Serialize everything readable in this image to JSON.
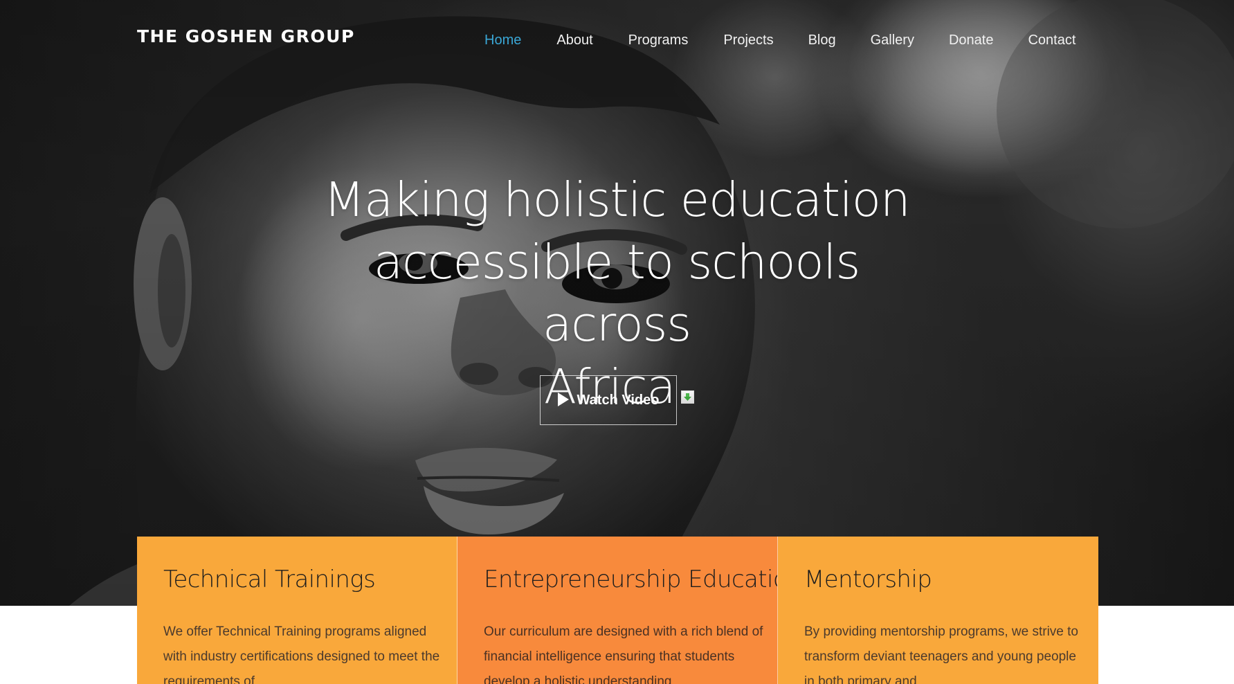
{
  "header": {
    "brand": "THE GOSHEN GROUP",
    "nav": [
      {
        "label": "Home"
      },
      {
        "label": "About"
      },
      {
        "label": "Programs"
      },
      {
        "label": "Projects"
      },
      {
        "label": "Blog"
      },
      {
        "label": "Gallery"
      },
      {
        "label": "Donate"
      },
      {
        "label": "Contact"
      }
    ]
  },
  "hero": {
    "title_line_1": "Making holistic education",
    "title_line_2": "accessible to schools across",
    "title_line_3": "Africa.",
    "watch_video": "Watch Video"
  },
  "cards": [
    {
      "title": "Technical Trainings",
      "text": "We offer Technical Training programs aligned with industry certifications designed to meet the requirements of"
    },
    {
      "title": "Entrepreneurship Education",
      "text": "Our curriculum are designed with a rich blend of financial intelligence ensuring that students develop a holistic understanding"
    },
    {
      "title": "Mentorship",
      "text": "By providing mentorship programs, we strive to transform deviant teenagers and young people in both primary and"
    }
  ],
  "colors": {
    "nav_active": "#3aa7d6",
    "card_orange": "#f9a83b",
    "card_deep_orange": "#f88a3c"
  },
  "icons": {
    "play": "play-icon",
    "download": "download-icon"
  }
}
